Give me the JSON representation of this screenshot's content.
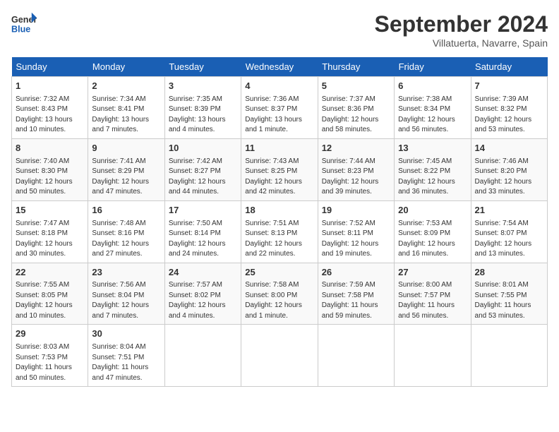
{
  "header": {
    "logo_line1": "General",
    "logo_line2": "Blue",
    "month": "September 2024",
    "location": "Villatuerta, Navarre, Spain"
  },
  "weekdays": [
    "Sunday",
    "Monday",
    "Tuesday",
    "Wednesday",
    "Thursday",
    "Friday",
    "Saturday"
  ],
  "weeks": [
    [
      {
        "day": "1",
        "sunrise": "Sunrise: 7:32 AM",
        "sunset": "Sunset: 8:43 PM",
        "daylight": "Daylight: 13 hours and 10 minutes."
      },
      {
        "day": "2",
        "sunrise": "Sunrise: 7:34 AM",
        "sunset": "Sunset: 8:41 PM",
        "daylight": "Daylight: 13 hours and 7 minutes."
      },
      {
        "day": "3",
        "sunrise": "Sunrise: 7:35 AM",
        "sunset": "Sunset: 8:39 PM",
        "daylight": "Daylight: 13 hours and 4 minutes."
      },
      {
        "day": "4",
        "sunrise": "Sunrise: 7:36 AM",
        "sunset": "Sunset: 8:37 PM",
        "daylight": "Daylight: 13 hours and 1 minute."
      },
      {
        "day": "5",
        "sunrise": "Sunrise: 7:37 AM",
        "sunset": "Sunset: 8:36 PM",
        "daylight": "Daylight: 12 hours and 58 minutes."
      },
      {
        "day": "6",
        "sunrise": "Sunrise: 7:38 AM",
        "sunset": "Sunset: 8:34 PM",
        "daylight": "Daylight: 12 hours and 56 minutes."
      },
      {
        "day": "7",
        "sunrise": "Sunrise: 7:39 AM",
        "sunset": "Sunset: 8:32 PM",
        "daylight": "Daylight: 12 hours and 53 minutes."
      }
    ],
    [
      {
        "day": "8",
        "sunrise": "Sunrise: 7:40 AM",
        "sunset": "Sunset: 8:30 PM",
        "daylight": "Daylight: 12 hours and 50 minutes."
      },
      {
        "day": "9",
        "sunrise": "Sunrise: 7:41 AM",
        "sunset": "Sunset: 8:29 PM",
        "daylight": "Daylight: 12 hours and 47 minutes."
      },
      {
        "day": "10",
        "sunrise": "Sunrise: 7:42 AM",
        "sunset": "Sunset: 8:27 PM",
        "daylight": "Daylight: 12 hours and 44 minutes."
      },
      {
        "day": "11",
        "sunrise": "Sunrise: 7:43 AM",
        "sunset": "Sunset: 8:25 PM",
        "daylight": "Daylight: 12 hours and 42 minutes."
      },
      {
        "day": "12",
        "sunrise": "Sunrise: 7:44 AM",
        "sunset": "Sunset: 8:23 PM",
        "daylight": "Daylight: 12 hours and 39 minutes."
      },
      {
        "day": "13",
        "sunrise": "Sunrise: 7:45 AM",
        "sunset": "Sunset: 8:22 PM",
        "daylight": "Daylight: 12 hours and 36 minutes."
      },
      {
        "day": "14",
        "sunrise": "Sunrise: 7:46 AM",
        "sunset": "Sunset: 8:20 PM",
        "daylight": "Daylight: 12 hours and 33 minutes."
      }
    ],
    [
      {
        "day": "15",
        "sunrise": "Sunrise: 7:47 AM",
        "sunset": "Sunset: 8:18 PM",
        "daylight": "Daylight: 12 hours and 30 minutes."
      },
      {
        "day": "16",
        "sunrise": "Sunrise: 7:48 AM",
        "sunset": "Sunset: 8:16 PM",
        "daylight": "Daylight: 12 hours and 27 minutes."
      },
      {
        "day": "17",
        "sunrise": "Sunrise: 7:50 AM",
        "sunset": "Sunset: 8:14 PM",
        "daylight": "Daylight: 12 hours and 24 minutes."
      },
      {
        "day": "18",
        "sunrise": "Sunrise: 7:51 AM",
        "sunset": "Sunset: 8:13 PM",
        "daylight": "Daylight: 12 hours and 22 minutes."
      },
      {
        "day": "19",
        "sunrise": "Sunrise: 7:52 AM",
        "sunset": "Sunset: 8:11 PM",
        "daylight": "Daylight: 12 hours and 19 minutes."
      },
      {
        "day": "20",
        "sunrise": "Sunrise: 7:53 AM",
        "sunset": "Sunset: 8:09 PM",
        "daylight": "Daylight: 12 hours and 16 minutes."
      },
      {
        "day": "21",
        "sunrise": "Sunrise: 7:54 AM",
        "sunset": "Sunset: 8:07 PM",
        "daylight": "Daylight: 12 hours and 13 minutes."
      }
    ],
    [
      {
        "day": "22",
        "sunrise": "Sunrise: 7:55 AM",
        "sunset": "Sunset: 8:05 PM",
        "daylight": "Daylight: 12 hours and 10 minutes."
      },
      {
        "day": "23",
        "sunrise": "Sunrise: 7:56 AM",
        "sunset": "Sunset: 8:04 PM",
        "daylight": "Daylight: 12 hours and 7 minutes."
      },
      {
        "day": "24",
        "sunrise": "Sunrise: 7:57 AM",
        "sunset": "Sunset: 8:02 PM",
        "daylight": "Daylight: 12 hours and 4 minutes."
      },
      {
        "day": "25",
        "sunrise": "Sunrise: 7:58 AM",
        "sunset": "Sunset: 8:00 PM",
        "daylight": "Daylight: 12 hours and 1 minute."
      },
      {
        "day": "26",
        "sunrise": "Sunrise: 7:59 AM",
        "sunset": "Sunset: 7:58 PM",
        "daylight": "Daylight: 11 hours and 59 minutes."
      },
      {
        "day": "27",
        "sunrise": "Sunrise: 8:00 AM",
        "sunset": "Sunset: 7:57 PM",
        "daylight": "Daylight: 11 hours and 56 minutes."
      },
      {
        "day": "28",
        "sunrise": "Sunrise: 8:01 AM",
        "sunset": "Sunset: 7:55 PM",
        "daylight": "Daylight: 11 hours and 53 minutes."
      }
    ],
    [
      {
        "day": "29",
        "sunrise": "Sunrise: 8:03 AM",
        "sunset": "Sunset: 7:53 PM",
        "daylight": "Daylight: 11 hours and 50 minutes."
      },
      {
        "day": "30",
        "sunrise": "Sunrise: 8:04 AM",
        "sunset": "Sunset: 7:51 PM",
        "daylight": "Daylight: 11 hours and 47 minutes."
      },
      null,
      null,
      null,
      null,
      null
    ]
  ]
}
